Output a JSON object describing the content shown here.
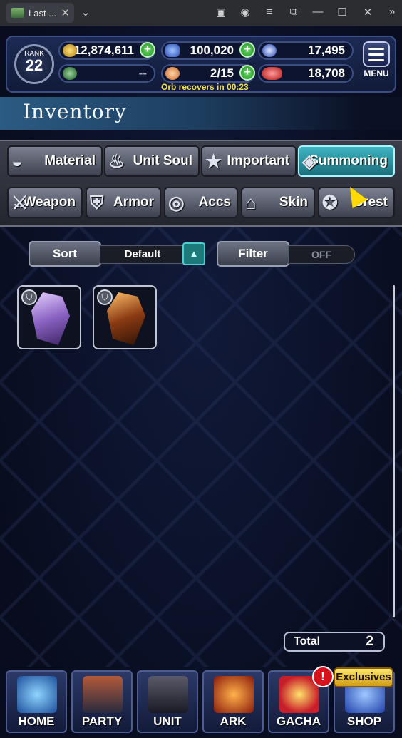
{
  "window": {
    "tab_title": "Last ...",
    "tab_close": "✕",
    "tab_dropdown": "⌄",
    "controls": [
      "▣",
      "◉",
      "≡",
      "⧉",
      "—",
      "☐",
      "✕",
      "»"
    ]
  },
  "status": {
    "rank_label": "RANK",
    "rank_value": "22",
    "gil": "12,874,611",
    "lapis": "100,020",
    "blue_currency": "17,495",
    "green_currency": "--",
    "orbs": "2/15",
    "red_currency": "18,708",
    "orb_recovery": "Orb recovers in 00:23",
    "menu_label": "MENU"
  },
  "inventory": {
    "title": "Inventory",
    "categories_row1": [
      "Material",
      "Unit Soul",
      "Important",
      "Summoning"
    ],
    "categories_row2": [
      "Weapon",
      "Armor",
      "Accs",
      "Skin",
      "Crest"
    ],
    "active_category": "Summoning",
    "sort_label": "Sort",
    "sort_value": "Default",
    "filter_label": "Filter",
    "filter_value": "OFF",
    "total_label": "Total",
    "total_value": "2",
    "items": [
      {
        "color_top": "#c6a8e8",
        "color_bottom": "#5a3d8c"
      },
      {
        "color_top": "#f0a24a",
        "color_bottom": "#3a1a0c"
      }
    ]
  },
  "nav": {
    "items": [
      "HOME",
      "PARTY",
      "UNIT",
      "ARK",
      "GACHA",
      "SHOP"
    ],
    "badge": "!",
    "exclusives_label": "Exclusives"
  },
  "colors": {
    "accent_teal": "#3fb4c2",
    "orb_text": "#f4e04a"
  }
}
